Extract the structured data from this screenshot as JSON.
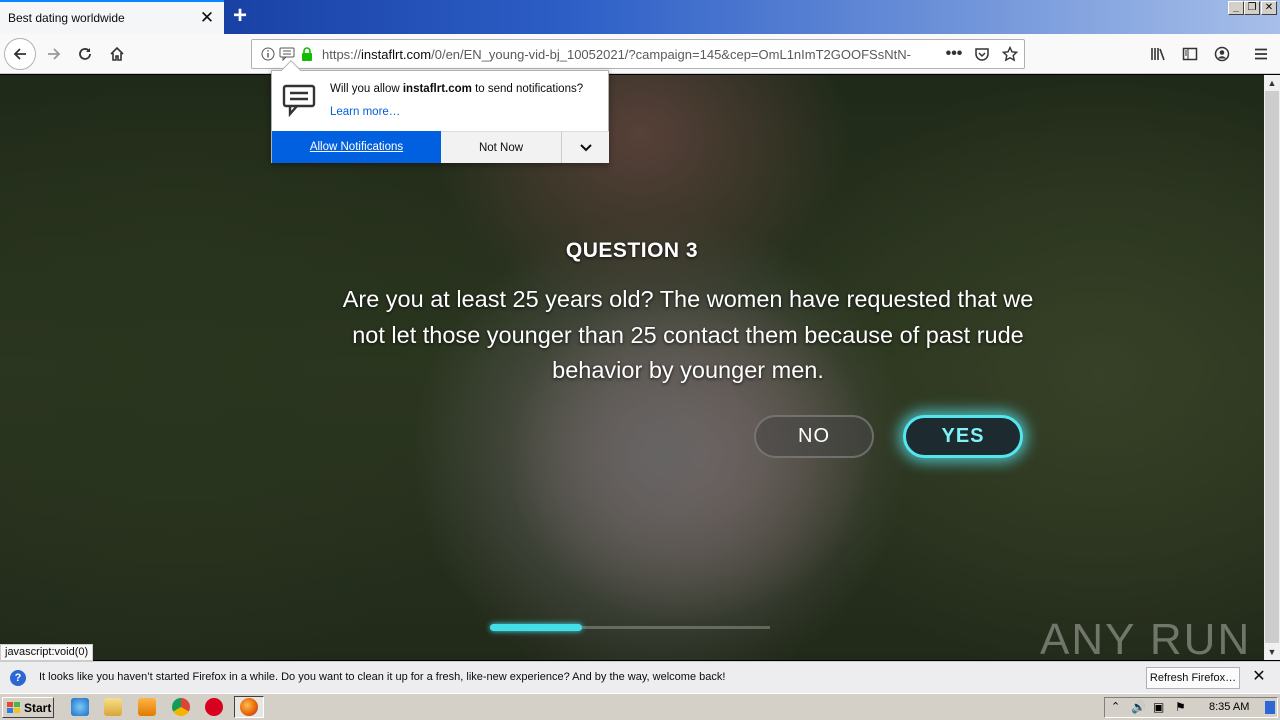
{
  "browser": {
    "tab_title": "Best dating worldwide",
    "url_prefix": "https://",
    "url_domain": "instaflrt.com",
    "url_path": "/0/en/EN_young-vid-bj_10052021/?campaign=145&cep=OmL1nImT2GOOFSsNtN-",
    "status_link": "javascript:void(0)"
  },
  "notification": {
    "message_prefix": "Will you allow ",
    "message_domain": "instaflrt.com",
    "message_suffix": " to send notifications?",
    "learn_more": "Learn more…",
    "allow_label": "Allow Notifications",
    "not_now_label": "Not Now"
  },
  "page": {
    "question_title": "QUESTION 3",
    "question_text": "Are you at least 25 years old? The women have requested that we not let those younger than 25 contact them because of past rude behavior by younger men.",
    "no_label": "NO",
    "yes_label": "YES",
    "progress": 0.33,
    "watermark": "ANY RUN"
  },
  "infobar": {
    "message": "It looks like you haven’t started Firefox in a while. Do you want to clean it up for a fresh, like-new experience? And by the way, welcome back!",
    "refresh_label": "Refresh Firefox…"
  },
  "taskbar": {
    "start_label": "Start",
    "clock": "8:35 AM"
  },
  "colors": {
    "accent": "#0060df",
    "yes_glow": "#53e6ef",
    "progress": "#43dfe8"
  }
}
